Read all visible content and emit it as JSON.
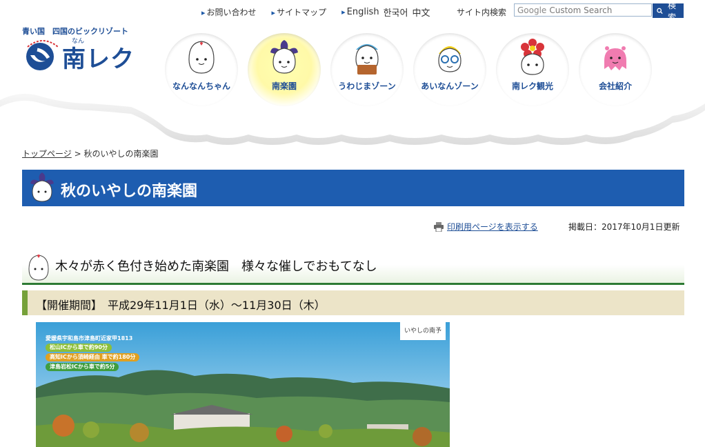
{
  "util": {
    "contact": "お問い合わせ",
    "sitemap": "サイトマップ",
    "lang_en": "English",
    "lang_ko": "한국어",
    "lang_zh": "中文",
    "site_search_label": "サイト内検索",
    "search_placeholder": "Custom Search",
    "search_brand": "Google",
    "search_button": "検索"
  },
  "logo": {
    "tagline": "青い国　四国のビックリゾート",
    "ruby": "なん",
    "name": "南レク"
  },
  "nav": [
    {
      "label": "なんなんちゃん",
      "active": false
    },
    {
      "label": "南楽園",
      "active": true
    },
    {
      "label": "うわじまゾーン",
      "active": false
    },
    {
      "label": "あいなんゾーン",
      "active": false
    },
    {
      "label": "南レク観光",
      "active": false
    },
    {
      "label": "会社紹介",
      "active": false
    }
  ],
  "breadcrumb": {
    "home": "トップページ",
    "sep": ">",
    "current": "秋のいやしの南楽園"
  },
  "page": {
    "title": "秋のいやしの南楽園",
    "print_link": "印刷用ページを表示する",
    "posted": "掲載日：2017年10月1日更新",
    "section_heading": "木々が赤く色付き始めた南楽園　様々な催しでおもてなし",
    "period": "【開催期間】　平成29年11月1日（水）～11月30日（木）"
  },
  "photo": {
    "address": "愛媛県宇和島市津島町近家甲1813",
    "access": [
      {
        "text": "松山ICから車で約90分",
        "color": "#8cbf3a"
      },
      {
        "text": "高知ICから須崎経由 車で約180分",
        "color": "#e0a020"
      },
      {
        "text": "津島岩松ICから車で約5分",
        "color": "#3f9d3f"
      }
    ],
    "sign": "いやしの南予"
  },
  "colors": {
    "brand_blue": "#1e4e96",
    "title_blue": "#1e5db0",
    "green": "#2d7a33"
  }
}
